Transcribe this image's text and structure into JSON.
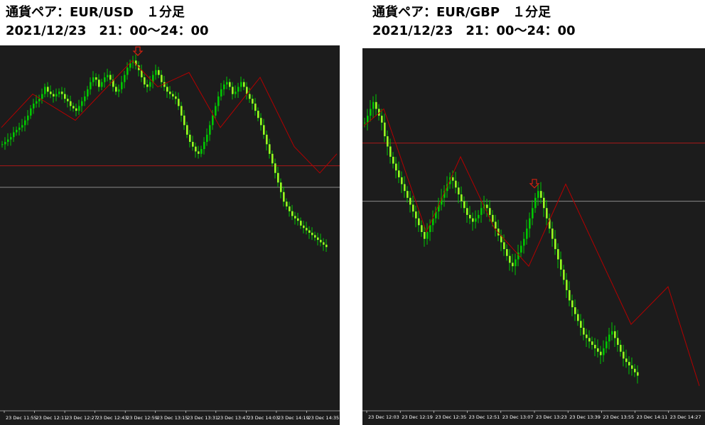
{
  "colors": {
    "background": "#1c1c1c",
    "bull": "#00c800",
    "bear": "#98ff20",
    "zigzag": "#b40000",
    "level_red": "#a81818",
    "level_grey": "#8a8a8a",
    "arrow": "#d02010",
    "axis_text": "#ffffff"
  },
  "chart_data": [
    {
      "type": "candlestick",
      "title": "通貨ペア：EUR/USD　１分足",
      "subtitle": "2021/12/23　21：00～24：00",
      "xlabel": "",
      "ylabel": "",
      "tick_labels": [
        "23 Dec 11:55",
        "23 Dec 12:11",
        "23 Dec 12:27",
        "23 Dec 12:43",
        "23 Dec 12:59",
        "23 Dec 13:15",
        "23 Dec 13:31",
        "23 Dec 13:47",
        "23 Dec 14:03",
        "23 Dec 14:19",
        "23 Dec 14:35"
      ],
      "ylim": [
        0,
        100
      ],
      "close": [
        64,
        65,
        66,
        67,
        69,
        70,
        71,
        72,
        74,
        76,
        79,
        81,
        82,
        83,
        85,
        88,
        86,
        85,
        84,
        85,
        86,
        85,
        83,
        82,
        80,
        79,
        78,
        80,
        82,
        84,
        87,
        90,
        92,
        91,
        88,
        90,
        92,
        93,
        91,
        88,
        86,
        87,
        90,
        93,
        96,
        98,
        99,
        97,
        95,
        92,
        89,
        88,
        90,
        93,
        95,
        93,
        90,
        88,
        86,
        85,
        84,
        83,
        80,
        76,
        72,
        68,
        65,
        63,
        61,
        60,
        62,
        65,
        68,
        72,
        76,
        80,
        84,
        87,
        89,
        90,
        88,
        85,
        86,
        88,
        90,
        88,
        85,
        83,
        81,
        78,
        75,
        72,
        68,
        64,
        60,
        56,
        52,
        48,
        44,
        40,
        38,
        36,
        34,
        33,
        32,
        30,
        29,
        28,
        27,
        26,
        25,
        24,
        23,
        22,
        21
      ],
      "zigzag": [
        [
          0,
          71
        ],
        [
          11,
          85
        ],
        [
          26,
          74
        ],
        [
          46,
          99
        ],
        [
          55,
          88
        ],
        [
          66,
          94
        ],
        [
          77,
          71
        ],
        [
          91,
          92
        ],
        [
          103,
          63
        ],
        [
          112,
          52
        ],
        [
          118,
          60
        ]
      ],
      "levels": [
        55,
        46
      ],
      "arrow_index": 48
    },
    {
      "type": "candlestick",
      "title": "通貨ペア：EUR/GBP　１分足",
      "subtitle": "2021/12/23　21：00～24：00",
      "xlabel": "",
      "ylabel": "",
      "tick_labels": [
        "23 Dec 12:03",
        "23 Dec 12:19",
        "23 Dec 12:35",
        "23 Dec 12:51",
        "23 Dec 13:07",
        "23 Dec 13:23",
        "23 Dec 13:39",
        "23 Dec 13:55",
        "23 Dec 14:11",
        "23 Dec 14:27"
      ],
      "ylim": [
        0,
        100
      ],
      "close": [
        82,
        84,
        86,
        88,
        86,
        84,
        82,
        78,
        75,
        72,
        70,
        68,
        66,
        64,
        62,
        60,
        58,
        56,
        54,
        52,
        50,
        48,
        50,
        52,
        54,
        56,
        58,
        60,
        62,
        64,
        66,
        65,
        63,
        61,
        59,
        57,
        55,
        54,
        53,
        54,
        55,
        57,
        58,
        57,
        55,
        53,
        51,
        49,
        47,
        45,
        43,
        41,
        40,
        42,
        44,
        46,
        48,
        51,
        54,
        57,
        60,
        62,
        60,
        57,
        54,
        51,
        48,
        45,
        42,
        39,
        36,
        33,
        30,
        28,
        26,
        24,
        22,
        20,
        19,
        18,
        17,
        16,
        15,
        14,
        16,
        18,
        20,
        21,
        19,
        17,
        15,
        13,
        12,
        11,
        10,
        9,
        8
      ],
      "zigzag": [
        [
          0,
          81
        ],
        [
          7,
          86
        ],
        [
          22,
          50
        ],
        [
          34,
          72
        ],
        [
          46,
          51
        ],
        [
          58,
          40
        ],
        [
          71,
          64
        ],
        [
          94,
          23
        ],
        [
          107,
          34
        ],
        [
          118,
          5
        ]
      ],
      "levels": [
        76,
        59
      ],
      "arrow_index": 60
    }
  ]
}
